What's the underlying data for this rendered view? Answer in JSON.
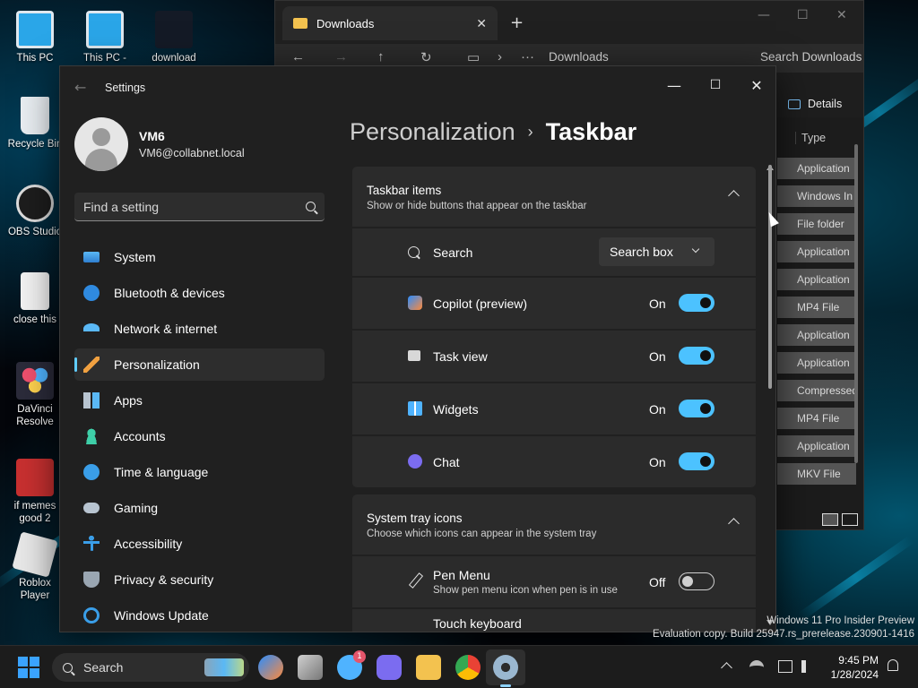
{
  "desktop": {
    "icons": [
      {
        "label": "This PC"
      },
      {
        "label": "This PC -"
      },
      {
        "label": "download"
      },
      {
        "label": "Recycle Bin"
      },
      {
        "label": "OBS Studio"
      },
      {
        "label": "close this"
      },
      {
        "label": "DaVinci Resolve"
      },
      {
        "label": "if memes good 2"
      },
      {
        "label": "Roblox Player"
      }
    ]
  },
  "explorer": {
    "tab_title": "Downloads",
    "path": "Downloads",
    "search_placeholder": "Search Downloads",
    "details_label": "Details",
    "column_type": "Type",
    "rows": [
      "Application",
      "Windows In",
      "File folder",
      "Application",
      "Application",
      "MP4 File",
      "Application",
      "Application",
      "Compressed",
      "MP4 File",
      "Application",
      "MKV File"
    ]
  },
  "settings": {
    "app_title": "Settings",
    "user": {
      "name": "VM6",
      "email": "VM6@collabnet.local"
    },
    "search_placeholder": "Find a setting",
    "nav": [
      {
        "label": "System",
        "icon": "system-icon"
      },
      {
        "label": "Bluetooth & devices",
        "icon": "bluetooth-icon"
      },
      {
        "label": "Network & internet",
        "icon": "wifi-icon"
      },
      {
        "label": "Personalization",
        "icon": "brush-icon"
      },
      {
        "label": "Apps",
        "icon": "apps-icon"
      },
      {
        "label": "Accounts",
        "icon": "accounts-icon"
      },
      {
        "label": "Time & language",
        "icon": "globe-clock-icon"
      },
      {
        "label": "Gaming",
        "icon": "gamepad-icon"
      },
      {
        "label": "Accessibility",
        "icon": "accessibility-icon"
      },
      {
        "label": "Privacy & security",
        "icon": "shield-icon"
      },
      {
        "label": "Windows Update",
        "icon": "update-icon"
      }
    ],
    "breadcrumb": {
      "parent": "Personalization",
      "separator": "›",
      "current": "Taskbar"
    },
    "taskbar_items": {
      "title": "Taskbar items",
      "subtitle": "Show or hide buttons that appear on the taskbar",
      "search": {
        "label": "Search",
        "value": "Search box"
      },
      "copilot": {
        "label": "Copilot (preview)",
        "state": "On"
      },
      "task_view": {
        "label": "Task view",
        "state": "On"
      },
      "widgets": {
        "label": "Widgets",
        "state": "On"
      },
      "chat": {
        "label": "Chat",
        "state": "On"
      }
    },
    "system_tray": {
      "title": "System tray icons",
      "subtitle": "Choose which icons can appear in the system tray",
      "pen_menu": {
        "label": "Pen Menu",
        "sub": "Show pen menu icon when pen is in use",
        "state": "Off"
      },
      "touch_keyboard": {
        "label": "Touch keyboard"
      }
    }
  },
  "watermark": {
    "line1": "Windows 11 Pro Insider Preview",
    "line2": "Evaluation copy. Build 25947.rs_prerelease.230901-1416"
  },
  "taskbar": {
    "search_label": "Search",
    "notification_count": "1",
    "time": "9:45 PM",
    "date": "1/28/2024"
  },
  "colors": {
    "accent": "#4cc2ff",
    "active_indicator": "#60cdff",
    "window_bg": "#202020",
    "card_bg": "#2b2b2b"
  }
}
